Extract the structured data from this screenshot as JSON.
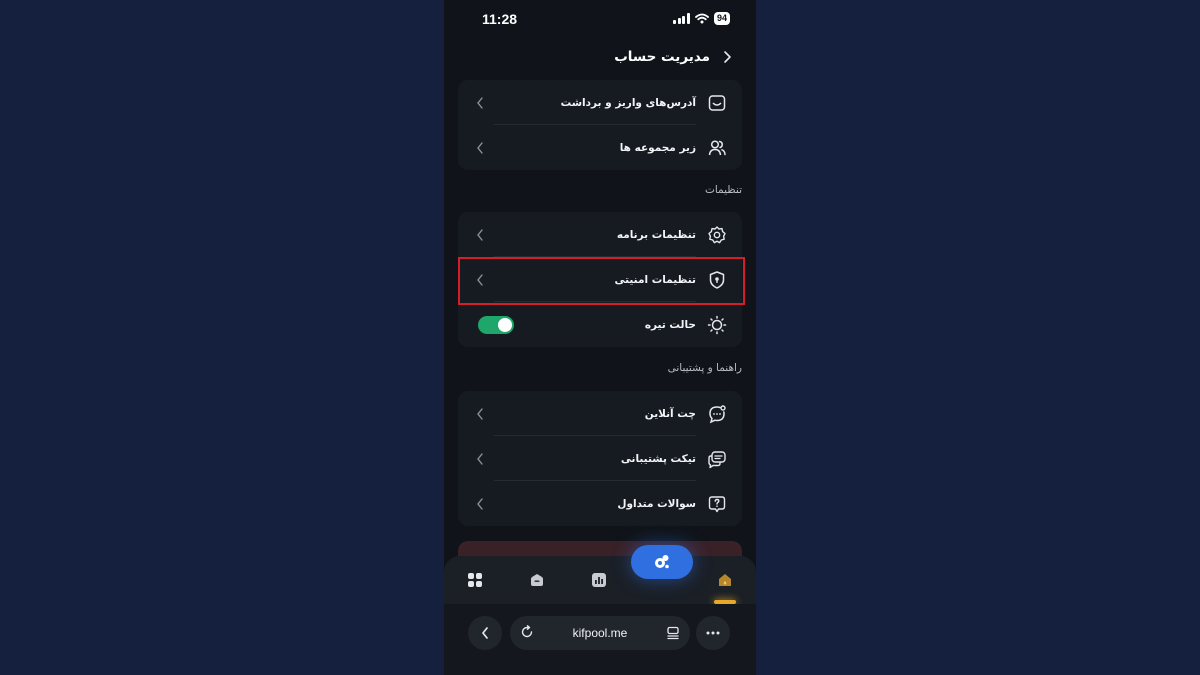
{
  "status_bar": {
    "time": "11:28",
    "battery": "94"
  },
  "header": {
    "title": "مدیریت حساب"
  },
  "account_items": [
    {
      "label": "آدرس‌های واریز و برداشت",
      "icon": "wallet-icon"
    },
    {
      "label": "زیر مجموعه ها",
      "icon": "users-icon"
    }
  ],
  "settings": {
    "section_title": "تنظیمات",
    "items": [
      {
        "label": "تنظیمات برنامه",
        "icon": "gear-icon"
      },
      {
        "label": "تنظیمات امنیتی",
        "icon": "shield-lock-icon"
      },
      {
        "label": "حالت تیره",
        "icon": "sun-icon",
        "toggle_on": true
      }
    ]
  },
  "support": {
    "section_title": "راهنما و پشتیبانی",
    "items": [
      {
        "label": "چت آنلاین",
        "icon": "chat-icon"
      },
      {
        "label": "تیکت پشتیبانی",
        "icon": "messages-icon"
      },
      {
        "label": "سوالات متداول",
        "icon": "question-icon"
      }
    ]
  },
  "bottom_nav": [
    "home-icon",
    "chart-icon",
    "wallet-box-icon",
    "apps-icon"
  ],
  "browser": {
    "url": "kifpool.me"
  },
  "colors": {
    "accent": "#2f6fe0",
    "toggle": "#1fa66b",
    "highlight": "#d41f2a",
    "home_active": "#e8a92a"
  }
}
